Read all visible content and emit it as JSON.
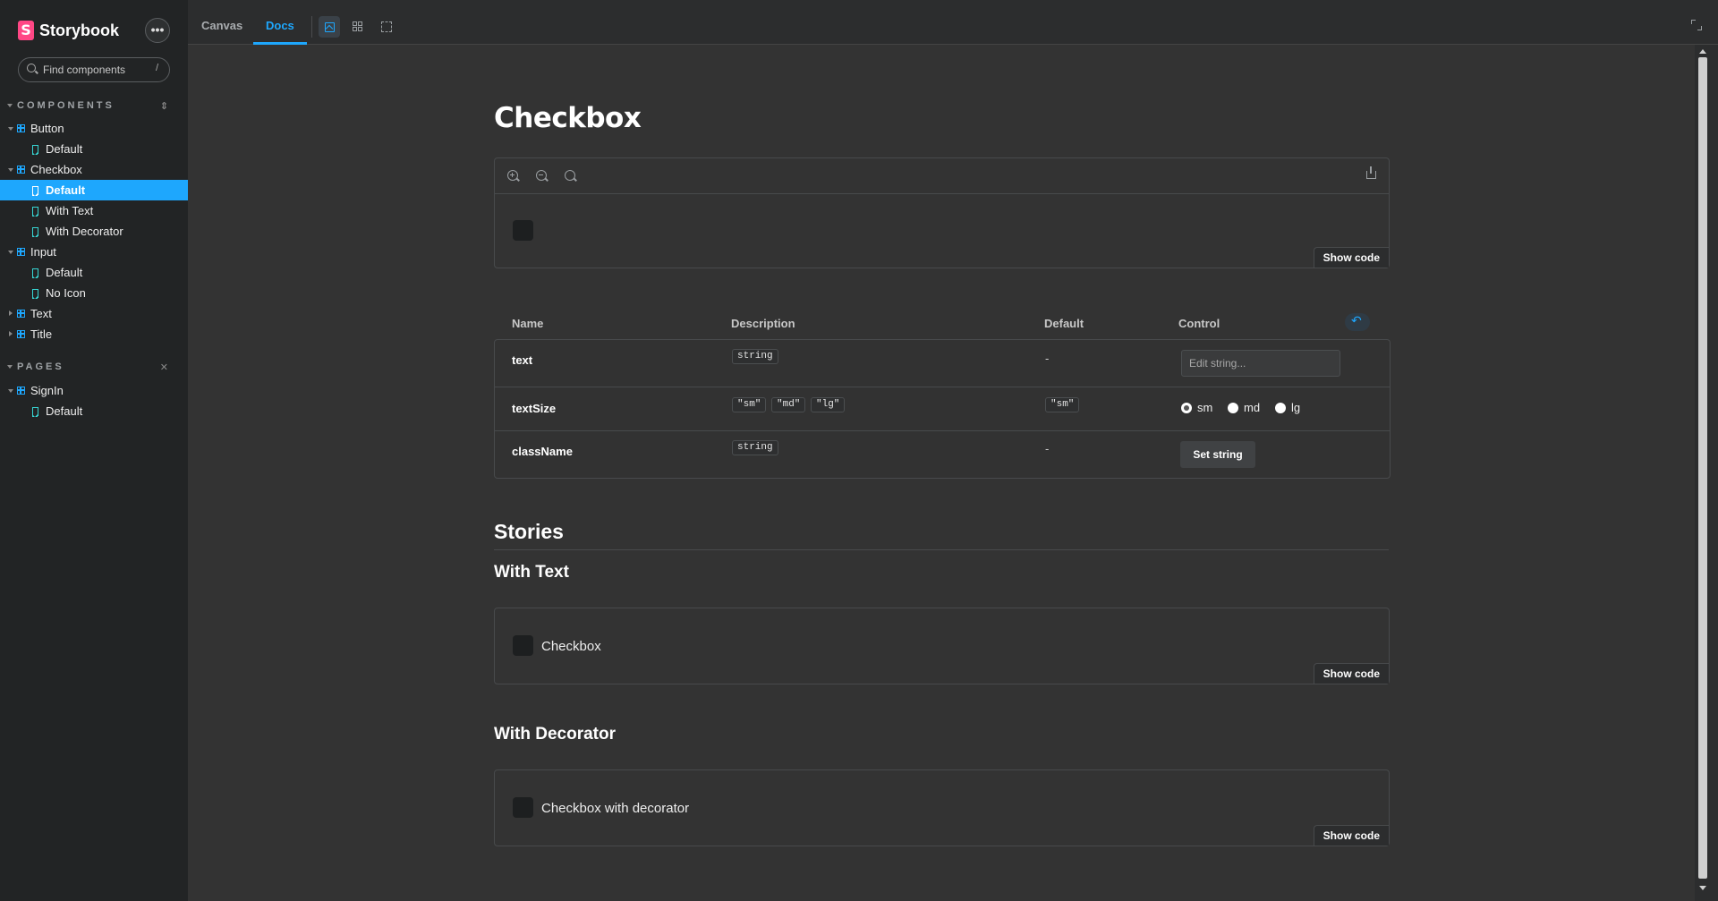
{
  "sidebar": {
    "brand": {
      "logo_letter": "S",
      "name": "Storybook",
      "accent": "#ff4785"
    },
    "menu_glyph": "•••",
    "search": {
      "placeholder": "Find components",
      "shortcut": "/"
    },
    "sections": {
      "components": {
        "title": "COMPONENTS",
        "tool_glyph": "⇕"
      },
      "pages": {
        "title": "PAGES",
        "tool_glyph": "✕"
      }
    },
    "components": {
      "button": {
        "label": "Button",
        "stories": [
          "Default"
        ]
      },
      "checkbox": {
        "label": "Checkbox",
        "stories": [
          "Default",
          "With Text",
          "With Decorator"
        ]
      },
      "input": {
        "label": "Input",
        "stories": [
          "Default",
          "No Icon"
        ]
      },
      "text": {
        "label": "Text"
      },
      "title": {
        "label": "Title"
      }
    },
    "pages": {
      "signin": {
        "label": "SignIn",
        "stories": [
          "Default"
        ]
      }
    },
    "selected_color": "#1ea7fd",
    "icons": {
      "component": "component-icon",
      "story": "bookmark-icon"
    }
  },
  "toolbar": {
    "tabs": {
      "canvas": "Canvas",
      "docs": "Docs"
    },
    "active_tab": "Docs",
    "icons": [
      "image-icon",
      "grid-icon",
      "outline-icon",
      "fullscreen-icon"
    ]
  },
  "docs": {
    "title": "Checkbox",
    "preview": {
      "show_code": "Show code",
      "icons": [
        "zoom-in-icon",
        "zoom-out-icon",
        "zoom-reset-icon",
        "share-icon"
      ]
    },
    "args_table": {
      "headers": {
        "name": "Name",
        "description": "Description",
        "default": "Default",
        "control": "Control"
      },
      "rows": [
        {
          "name": "text",
          "types": [
            "string"
          ],
          "default": "-",
          "control_placeholder": "Edit string..."
        },
        {
          "name": "textSize",
          "types": [
            "\"sm\"",
            "\"md\"",
            "\"lg\""
          ],
          "default": "\"sm\"",
          "options": [
            "sm",
            "md",
            "lg"
          ],
          "selected": "sm"
        },
        {
          "name": "className",
          "types": [
            "string"
          ],
          "default": "-",
          "control_button": "Set string"
        }
      ]
    },
    "stories_heading": "Stories",
    "stories": [
      {
        "title": "With Text",
        "checkbox_label": "Checkbox",
        "show_code": "Show code"
      },
      {
        "title": "With Decorator",
        "checkbox_label": "Checkbox with decorator",
        "show_code": "Show code"
      }
    ]
  }
}
